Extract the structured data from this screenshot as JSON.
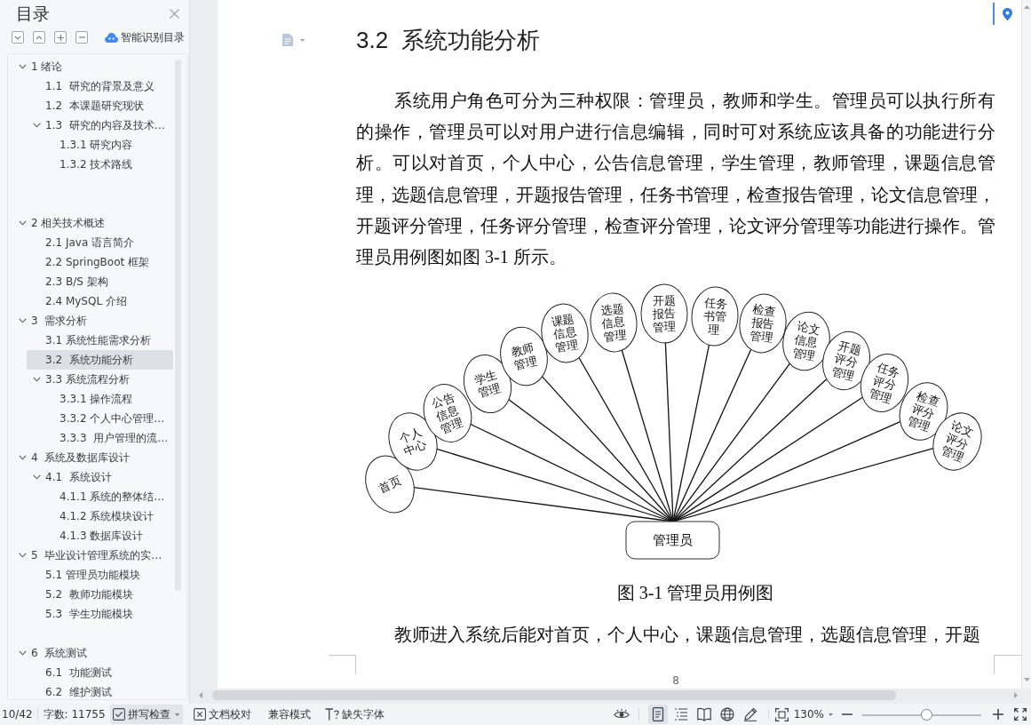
{
  "sidebar": {
    "title": "目录",
    "smart_button": "智能识别目录",
    "toc": [
      {
        "kind": "entry",
        "label": "1 绪论",
        "selected": false,
        "expanded": true,
        "children": [
          {
            "kind": "entry",
            "label": "1.1  研究的背景及意义",
            "selected": false
          },
          {
            "kind": "entry",
            "label": "1.2  本课题研究现状",
            "selected": false
          },
          {
            "kind": "entry",
            "label": "1.3  研究的内容及技术…",
            "selected": false,
            "expanded": true,
            "children": [
              {
                "kind": "entry",
                "label": "1.3.1 研究内容",
                "selected": false
              },
              {
                "kind": "entry",
                "label": "1.3.2 技术路线",
                "selected": false
              }
            ]
          }
        ]
      },
      {
        "kind": "blank"
      },
      {
        "kind": "blank"
      },
      {
        "kind": "entry",
        "label": "2 相关技术概述",
        "selected": false,
        "expanded": true,
        "children": [
          {
            "kind": "entry",
            "label": "2.1 Java 语言简介",
            "selected": false
          },
          {
            "kind": "entry",
            "label": "2.2 SpringBoot 框架",
            "selected": false
          },
          {
            "kind": "entry",
            "label": "2.3 B/S 架构",
            "selected": false
          },
          {
            "kind": "entry",
            "label": "2.4 MySQL 介绍",
            "selected": false
          }
        ]
      },
      {
        "kind": "entry",
        "label": "3  需求分析",
        "selected": false,
        "expanded": true,
        "children": [
          {
            "kind": "entry",
            "label": "3.1 系统性能需求分析",
            "selected": false
          },
          {
            "kind": "entry",
            "label": "3.2  系统功能分析",
            "selected": true
          },
          {
            "kind": "entry",
            "label": "3.3 系统流程分析",
            "selected": false,
            "expanded": true,
            "children": [
              {
                "kind": "entry",
                "label": "3.3.1 操作流程",
                "selected": false
              },
              {
                "kind": "entry",
                "label": "3.3.2 个人中心管理…",
                "selected": false
              },
              {
                "kind": "entry",
                "label": "3.3.3  用户管理的流…",
                "selected": false
              }
            ]
          }
        ]
      },
      {
        "kind": "entry",
        "label": "4  系统及数据库设计",
        "selected": false,
        "expanded": true,
        "children": [
          {
            "kind": "entry",
            "label": "4.1  系统设计",
            "selected": false,
            "expanded": true,
            "children": [
              {
                "kind": "entry",
                "label": "4.1.1 系统的整体结…",
                "selected": false
              },
              {
                "kind": "entry",
                "label": "4.1.2 系统模块设计",
                "selected": false
              },
              {
                "kind": "entry",
                "label": "4.1.3 数据库设计",
                "selected": false
              }
            ]
          }
        ]
      },
      {
        "kind": "entry",
        "label": "5  毕业设计管理系统的实…",
        "selected": false,
        "expanded": true,
        "children": [
          {
            "kind": "entry",
            "label": "5.1 管理员功能模块",
            "selected": false
          },
          {
            "kind": "entry",
            "label": "5.2  教师功能模块",
            "selected": false
          },
          {
            "kind": "entry",
            "label": "5.3  学生功能模块",
            "selected": false
          }
        ]
      },
      {
        "kind": "blank"
      },
      {
        "kind": "entry",
        "label": "6  系统测试",
        "selected": false,
        "expanded": true,
        "children": [
          {
            "kind": "entry",
            "label": "6.1  功能测试",
            "selected": false
          },
          {
            "kind": "entry",
            "label": "6.2  维护测试",
            "selected": false
          }
        ]
      }
    ]
  },
  "document": {
    "heading": "3.2  系统功能分析",
    "content": [
      {
        "kind": "paragraph",
        "text": "系统用户角色可分为三种权限：管理员，教师和学生。管理员可以执行所有的操作，管理员可以对用户进行信息编辑，同时可对系统应该具备的功能进行分析。可以对首页，个人中心，公告信息管理，学生管理，教师管理，课题信息管理，选题信息管理，开题报告管理，任务书管理，检查报告管理，论文信息管理，开题评分管理，任务评分管理，检查评分管理，论文评分管理等功能进行操作。管理员用例图如图 3-1 所示。"
      },
      {
        "kind": "figure",
        "actor": "管理员",
        "use_cases": [
          "首页",
          "个人中心",
          "公告信息管理",
          "学生管理",
          "教师管理",
          "课题信息管理",
          "选题信息管理",
          "开题报告管理",
          "任务书管理",
          "检查报告管理",
          "论文信息管理",
          "开题评分管理",
          "任务评分管理",
          "检查评分管理",
          "论文评分管理"
        ],
        "caption": "图 3-1 管理员用例图"
      },
      {
        "kind": "paragraph",
        "text": "教师进入系统后能对首页，个人中心，课题信息管理，选题信息管理，开题"
      }
    ],
    "page_number": "8"
  },
  "status_bar": {
    "page": "10/42",
    "word_count": "字数: 11755",
    "tools": [
      {
        "label": "拼写检查",
        "on": true,
        "has_menu": true
      },
      {
        "label": "文档校对",
        "on": false,
        "has_menu": false
      },
      {
        "label": "兼容模式",
        "on": false,
        "has_menu": false
      },
      {
        "label": "缺失字体",
        "on": false,
        "has_menu": false
      }
    ],
    "view_modes": [
      {
        "selected": true
      },
      {
        "selected": false
      },
      {
        "selected": false
      },
      {
        "selected": false
      },
      {
        "selected": false
      }
    ],
    "zoom": {
      "label": "130%",
      "level": 0.54
    }
  }
}
